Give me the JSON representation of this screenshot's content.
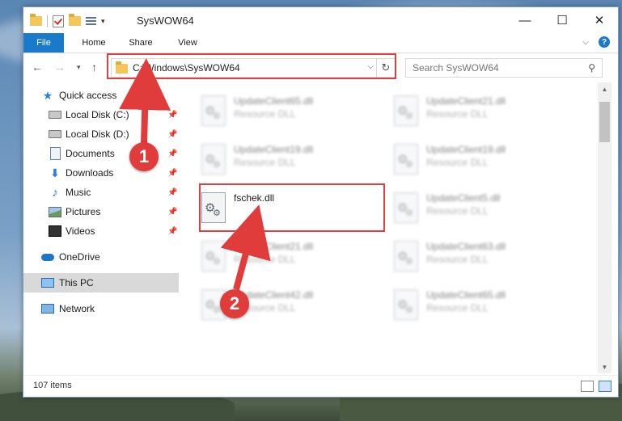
{
  "window": {
    "title": "SysWOW64",
    "controls": {
      "minimize": "—",
      "maximize": "☐",
      "close": "✕"
    }
  },
  "ribbon": {
    "tabs": [
      "File",
      "Home",
      "Share",
      "View"
    ],
    "help": "?"
  },
  "address": {
    "path": "C:\\Windows\\SysWOW64",
    "search_placeholder": "Search SysWOW64"
  },
  "sidebar": {
    "quick_access": "Quick access",
    "items": [
      {
        "label": "Local Disk (C:)",
        "icon": "drive-icon"
      },
      {
        "label": "Local Disk (D:)",
        "icon": "drive-icon"
      },
      {
        "label": "Documents",
        "icon": "documents-icon"
      },
      {
        "label": "Downloads",
        "icon": "downloads-icon"
      },
      {
        "label": "Music",
        "icon": "music-icon"
      },
      {
        "label": "Pictures",
        "icon": "pictures-icon"
      },
      {
        "label": "Videos",
        "icon": "videos-icon"
      }
    ],
    "onedrive": "OneDrive",
    "this_pc": "This PC",
    "network": "Network"
  },
  "files": [
    {
      "name": "UpdateClient65.dll",
      "desc": "Resource DLL"
    },
    {
      "name": "UpdateClient21.dll",
      "desc": "Resource DLL"
    },
    {
      "name": "UpdateClient19.dll",
      "desc": "Resource DLL"
    },
    {
      "name": "UpdateClient19.dll",
      "desc": "Resource DLL"
    },
    {
      "name": "fschek.dll",
      "desc": ""
    },
    {
      "name": "UpdateClient5.dll",
      "desc": "Resource DLL"
    },
    {
      "name": "UpdateClient21.dll",
      "desc": "Resource DLL"
    },
    {
      "name": "UpdateClient63.dll",
      "desc": "Resource DLL"
    },
    {
      "name": "UpdateClient42.dll",
      "desc": "Resource DLL"
    },
    {
      "name": "UpdateClient65.dll",
      "desc": "Resource DLL"
    }
  ],
  "status": {
    "count": "107 items"
  },
  "callouts": [
    "1",
    "2"
  ],
  "colors": {
    "accent": "#1979ca",
    "highlight": "#e04040",
    "callout": "#e03c3c"
  }
}
